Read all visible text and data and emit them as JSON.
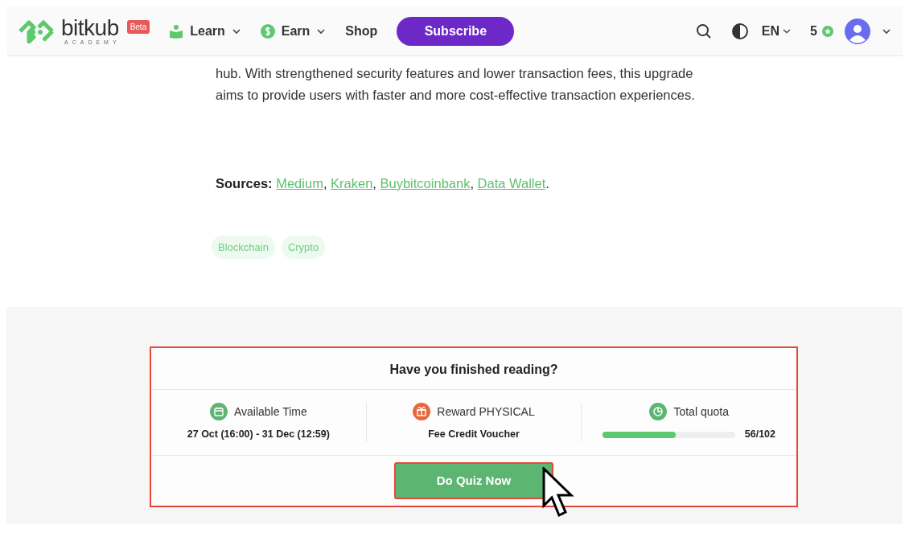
{
  "header": {
    "logo": {
      "word": "bitkub",
      "sub": "ACADEMY",
      "badge": "Beta"
    },
    "nav": [
      {
        "kind": "learn",
        "label": "Learn",
        "dropdown": true
      },
      {
        "kind": "earn",
        "label": "Earn",
        "dropdown": true
      },
      {
        "kind": "plain",
        "label": "Shop",
        "dropdown": false
      }
    ],
    "subscribe": "Subscribe",
    "language": "EN",
    "points": "5"
  },
  "article": {
    "paragraph": "hub. With strengthened security features and lower transaction fees, this upgrade aims to provide users with faster and more cost-effective transaction experiences.",
    "sources": {
      "label": "Sources:",
      "links": [
        {
          "label": "Medium",
          "separator": ","
        },
        {
          "label": "Kraken",
          "separator": ","
        },
        {
          "label": "Buybitcoinbank",
          "separator": ","
        },
        {
          "label": "Data Wallet",
          "separator": "."
        }
      ]
    },
    "tags": [
      "Blockchain",
      "Crypto"
    ]
  },
  "quiz": {
    "title": "Have you finished reading?",
    "stats": [
      {
        "kind": "time",
        "label": "Available Time",
        "value": "27 Oct (16:00) - 31 Dec (12:59)"
      },
      {
        "kind": "reward",
        "label": "Reward PHYSICAL",
        "value": "Fee Credit Voucher"
      },
      {
        "kind": "quota",
        "label": "Total quota",
        "level": 0.55,
        "reading": "56/102"
      }
    ],
    "button": "Do Quiz Now"
  }
}
